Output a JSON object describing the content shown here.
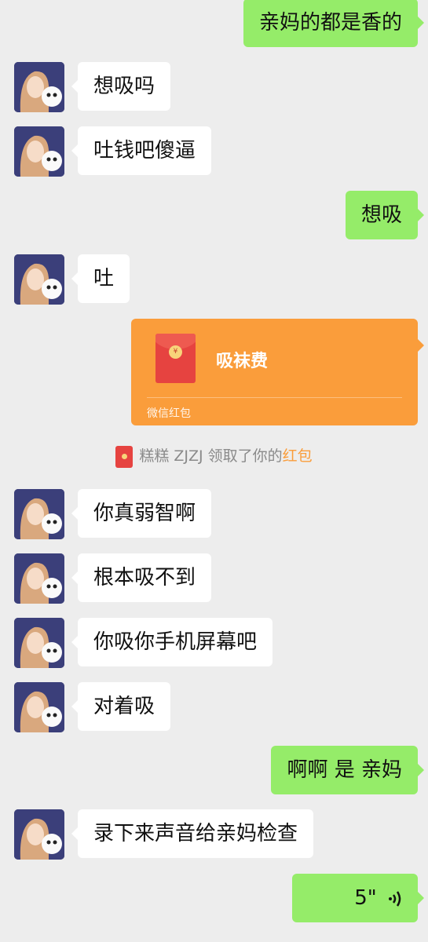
{
  "messages": [
    {
      "side": "out",
      "text": "亲妈的都是香的"
    },
    {
      "side": "in",
      "text": "想吸吗"
    },
    {
      "side": "in",
      "text": "吐钱吧傻逼"
    },
    {
      "side": "out",
      "text": "想吸"
    },
    {
      "side": "in",
      "text": "吐"
    },
    {
      "side": "out",
      "type": "red_packet",
      "title": "吸袜费",
      "footer": "微信红包"
    },
    {
      "side": "in",
      "text": "你真弱智啊"
    },
    {
      "side": "in",
      "text": "根本吸不到"
    },
    {
      "side": "in",
      "text": "你吸你手机屏幕吧"
    },
    {
      "side": "in",
      "text": "对着吸"
    },
    {
      "side": "out",
      "text": "啊啊 是 亲妈"
    },
    {
      "side": "in",
      "text": "录下来声音给亲妈检查"
    },
    {
      "side": "out",
      "type": "voice",
      "duration": "5\""
    }
  ],
  "red_packet": {
    "coin_symbol": "¥",
    "title": "吸袜费",
    "footer": "微信红包"
  },
  "system_notice": {
    "prefix": "糕糕 ZJZJ 领取了你的",
    "link": "红包"
  },
  "voice": {
    "duration": "5\"",
    "icon": "voice-wave-icon"
  },
  "colors": {
    "outgoing": "#95ec69",
    "incoming": "#ffffff",
    "red_packet": "#fa9d3b",
    "background": "#ededed"
  }
}
